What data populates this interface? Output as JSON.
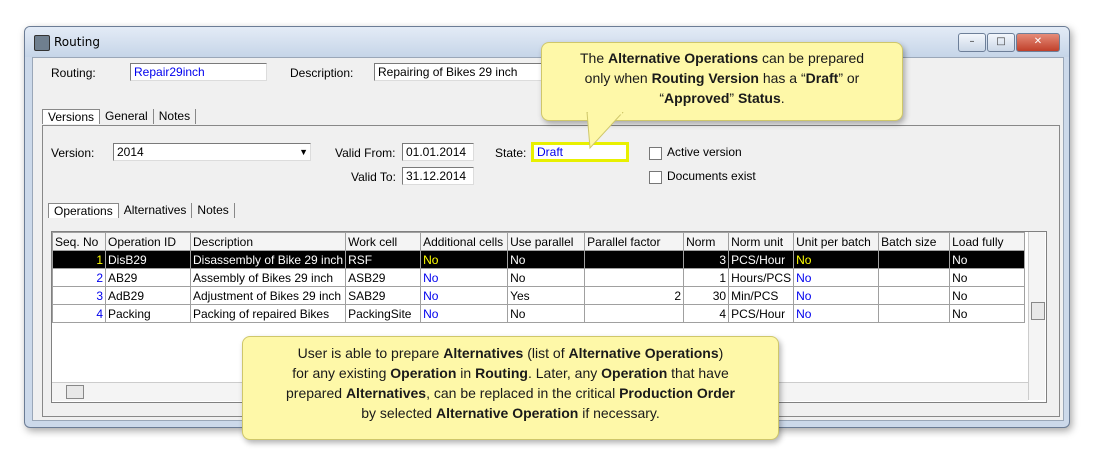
{
  "window": {
    "title": "Routing"
  },
  "header": {
    "routing_label": "Routing:",
    "routing_value": "Repair29inch",
    "description_label": "Description:",
    "description_value": "Repairing of Bikes 29 inch"
  },
  "tabs_top": [
    "Versions",
    "General",
    "Notes"
  ],
  "version": {
    "version_label": "Version:",
    "version_value": "2014",
    "valid_from_label": "Valid From:",
    "valid_from_value": "01.01.2014",
    "valid_to_label": "Valid To:",
    "valid_to_value": "31.12.2014",
    "state_label": "State:",
    "state_value": "Draft",
    "active_label": "Active version",
    "docs_label": "Documents exist"
  },
  "tabs_inner": [
    "Operations",
    "Alternatives",
    "Notes"
  ],
  "grid": {
    "columns": [
      "Seq. No",
      "Operation ID",
      "Description",
      "Work cell",
      "Additional cells",
      "Use parallel",
      "Parallel factor",
      "Norm",
      "Norm unit",
      "Unit per batch",
      "Batch size",
      "Load fully"
    ],
    "rows": [
      [
        "1",
        "DisB29",
        "Disassembly of Bike 29 inch",
        "RSF",
        "No",
        "No",
        "",
        "3",
        "PCS/Hour",
        "No",
        "",
        "No"
      ],
      [
        "2",
        "AB29",
        "Assembly of Bikes 29 inch",
        "ASB29",
        "No",
        "No",
        "",
        "1",
        "Hours/PCS",
        "No",
        "",
        "No"
      ],
      [
        "3",
        "AdB29",
        "Adjustment of Bikes 29 inch",
        "SAB29",
        "No",
        "Yes",
        "2",
        "30",
        "Min/PCS",
        "No",
        "",
        "No"
      ],
      [
        "4",
        "Packing",
        "Packing of repaired Bikes",
        "PackingSite",
        "No",
        "No",
        "",
        "4",
        "PCS/Hour",
        "No",
        "",
        "No"
      ]
    ]
  },
  "callout_top": {
    "t1": "The ",
    "b1": "Alternative Operations",
    "t2": " can be prepared",
    "t3": "only when ",
    "b2": "Routing Version",
    "t4": " has a “",
    "b3": "Draft",
    "t5": "” or",
    "t6": "“",
    "b4": "Approved",
    "t7": "” ",
    "b5": "Status",
    "t8": "."
  },
  "callout_bottom": {
    "l1a": "User is able to prepare ",
    "l1b": "Alternatives",
    "l1c": " (list of ",
    "l1d": "Alternative Operations",
    "l1e": ")",
    "l2a": "for any existing ",
    "l2b": "Operation",
    "l2c": " in ",
    "l2d": "Routing",
    "l2e": ".  Later, any ",
    "l2f": "Operation",
    "l2g": " that have",
    "l3a": "prepared ",
    "l3b": "Alternatives",
    "l3c": ", can be replaced in the critical ",
    "l3d": "Production  Order",
    "l4a": "by selected ",
    "l4b": "Alternative Operation",
    "l4c": " if necessary."
  },
  "colors": {
    "accent_highlight": "#e8f000",
    "selected_row": "#000000",
    "link_blue": "#0000ee"
  }
}
